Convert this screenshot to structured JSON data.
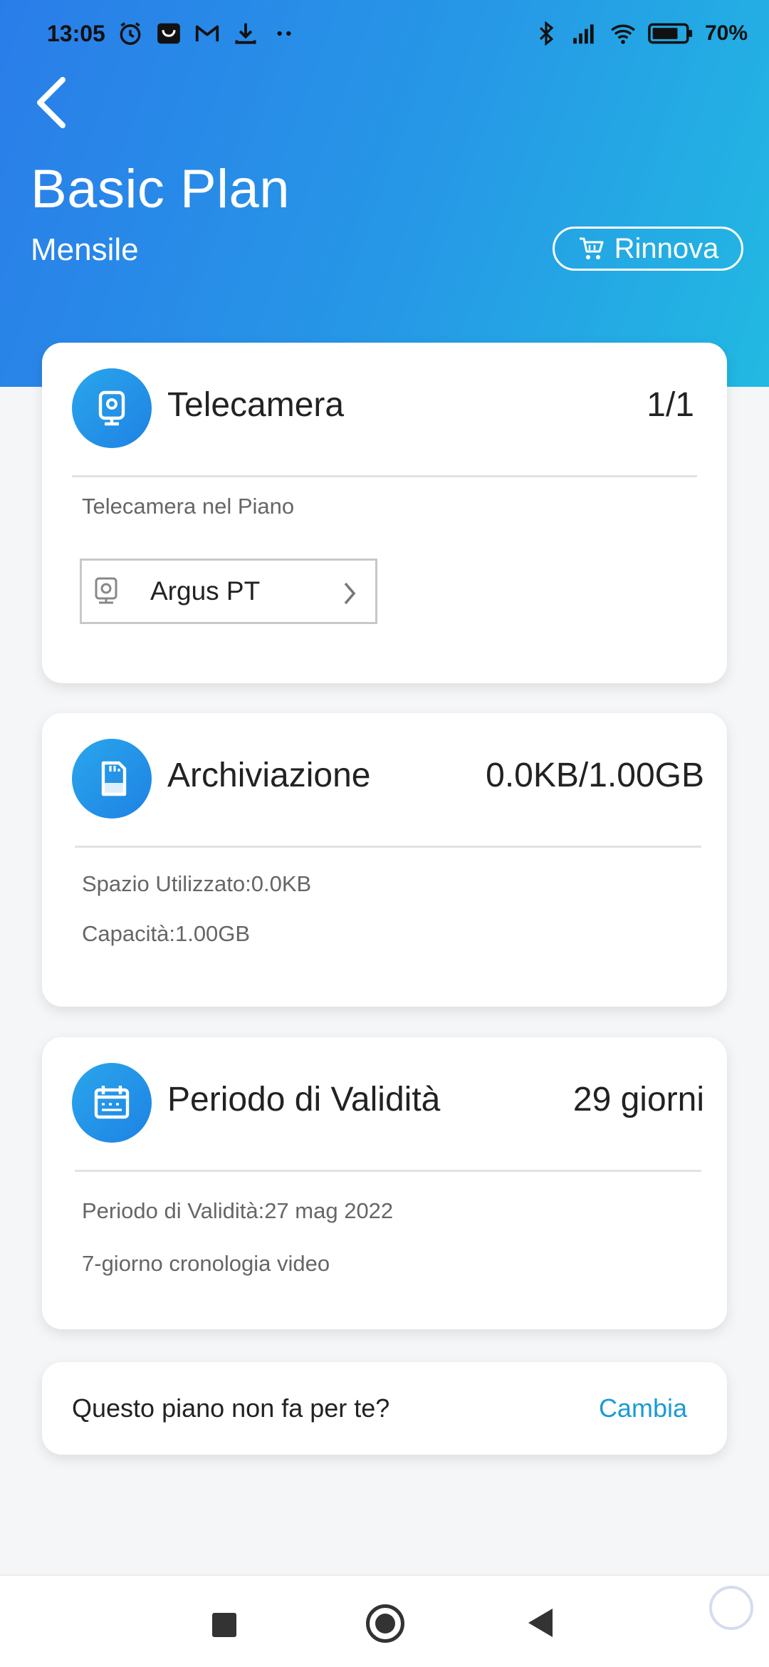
{
  "status_bar": {
    "time": "13:05",
    "battery_percent": "70%",
    "left_icons": [
      "alarm-icon",
      "shopping-bag-icon",
      "gmail-icon",
      "download-icon",
      "more-dots-icon"
    ],
    "right_icons": [
      "bluetooth-icon",
      "signal-icon",
      "wifi-icon",
      "battery-icon"
    ]
  },
  "header": {
    "title": "Basic Plan",
    "subtitle": "Mensile",
    "renew_label": "Rinnova",
    "gradient_start": "#2a7de9",
    "gradient_end": "#22b9e2"
  },
  "camera_card": {
    "title": "Telecamera",
    "value": "1/1",
    "section_label": "Telecamera nel Piano",
    "device_name": "Argus PT"
  },
  "storage_card": {
    "title": "Archiviazione",
    "value": "0.0KB/1.00GB",
    "used": "Spazio Utilizzato:0.0KB",
    "capacity": "Capacità:1.00GB"
  },
  "validity_card": {
    "title": "Periodo di Validità",
    "value": "29 giorni",
    "period": "Periodo di Validità:27 mag 2022",
    "history": "7-giorno cronologia video"
  },
  "change_plan": {
    "question": "Questo piano non fa per te?",
    "link": "Cambia",
    "link_color": "#1a9ad6"
  },
  "accent_color": "#1e82e3"
}
